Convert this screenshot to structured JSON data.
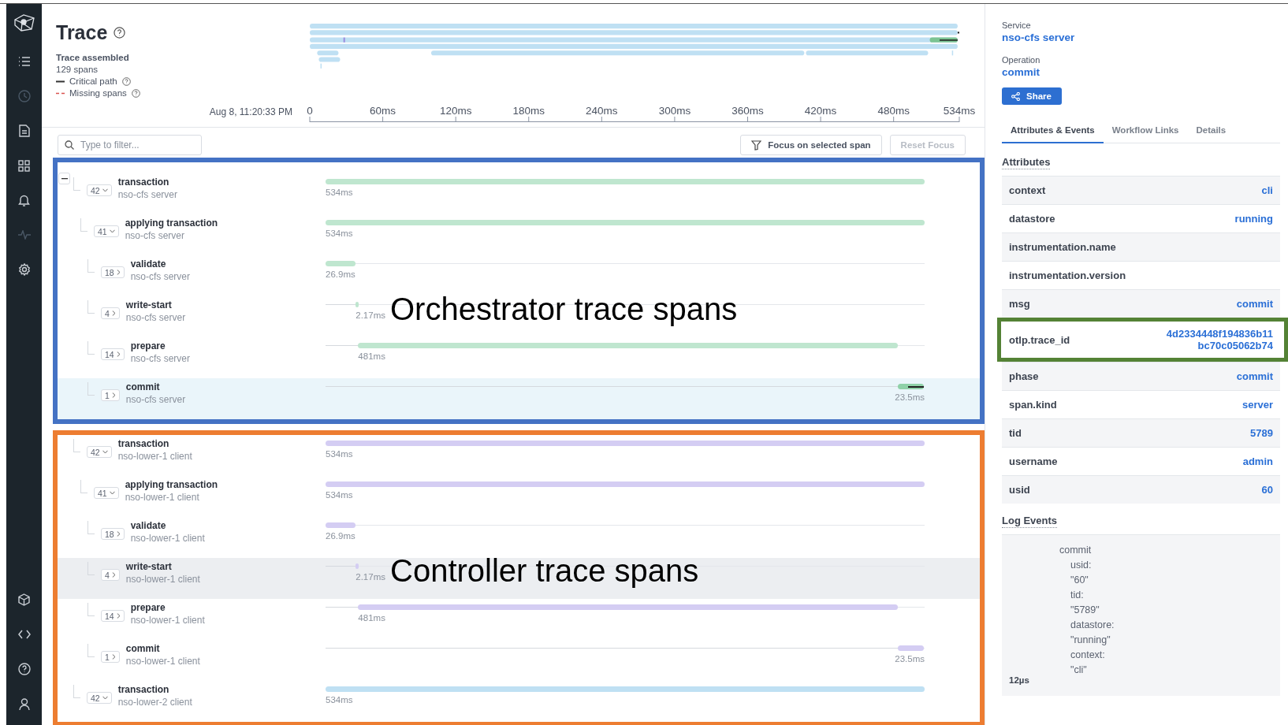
{
  "sidebar": {
    "items": [
      {
        "kind": "list",
        "disabled": false
      },
      {
        "kind": "clock",
        "disabled": true
      },
      {
        "kind": "document",
        "disabled": false
      },
      {
        "kind": "grid",
        "disabled": false
      },
      {
        "kind": "bell",
        "disabled": false
      },
      {
        "kind": "pulse",
        "disabled": true
      },
      {
        "kind": "gear",
        "disabled": false
      }
    ],
    "bottom_items": [
      {
        "kind": "cube",
        "disabled": false
      },
      {
        "kind": "code",
        "disabled": false
      },
      {
        "kind": "help",
        "disabled": false
      },
      {
        "kind": "user",
        "disabled": false
      }
    ]
  },
  "header": {
    "title": "Trace",
    "status": "Trace assembled",
    "span_count": "129 spans",
    "legend": [
      {
        "kind": "solid",
        "label": "Critical path"
      },
      {
        "kind": "dashed",
        "label": "Missing spans"
      }
    ],
    "timestamp": "Aug 8, 11:20:33 PM",
    "ticks": [
      "0",
      "60ms",
      "120ms",
      "180ms",
      "240ms",
      "300ms",
      "360ms",
      "420ms",
      "480ms",
      "534ms"
    ]
  },
  "filter": {
    "placeholder": "Type to filter..."
  },
  "focus_button": {
    "label": "Focus on selected span",
    "disabled": false
  },
  "reset_button": {
    "label": "Reset Focus",
    "disabled": true
  },
  "groups": [
    {
      "annotation": {
        "label": "Orchestrator trace spans",
        "color": "#4472c4"
      },
      "spans": [
        {
          "name": "transaction",
          "service": "nso-cfs server",
          "count": "42",
          "expanded": true,
          "duration": "534ms",
          "color": "#bfe6cf",
          "selected": false,
          "hovered": false,
          "children": [
            {
              "name": "applying transaction",
              "service": "nso-cfs server",
              "count": "41",
              "expanded": true,
              "duration": "534ms",
              "color": "#bfe6cf",
              "selected": false,
              "hovered": false,
              "children": [
                {
                  "name": "validate",
                  "service": "nso-cfs server",
                  "count": "18",
                  "expanded": false,
                  "duration": "26.9ms",
                  "color": "#bfe6cf",
                  "selected": false,
                  "hovered": false
                },
                {
                  "name": "write-start",
                  "service": "nso-cfs server",
                  "count": "4",
                  "expanded": false,
                  "duration": "2.17ms",
                  "color": "#bfe6cf",
                  "selected": false,
                  "hovered": false
                },
                {
                  "name": "prepare",
                  "service": "nso-cfs server",
                  "count": "14",
                  "expanded": false,
                  "duration": "481ms",
                  "color": "#bfe6cf",
                  "selected": false,
                  "hovered": false
                },
                {
                  "name": "commit",
                  "service": "nso-cfs server",
                  "count": "1",
                  "expanded": false,
                  "duration": "23.5ms",
                  "color": "#8fd1a8",
                  "selected": true,
                  "hovered": false
                }
              ]
            }
          ]
        }
      ]
    },
    {
      "annotation": {
        "label": "Controller trace spans",
        "color": "#ed7d31"
      },
      "spans": [
        {
          "name": "transaction",
          "service": "nso-lower-1 client",
          "count": "42",
          "expanded": true,
          "duration": "534ms",
          "color": "#d4cdf3",
          "selected": false,
          "hovered": false,
          "children": [
            {
              "name": "applying transaction",
              "service": "nso-lower-1 client",
              "count": "41",
              "expanded": true,
              "duration": "534ms",
              "color": "#d4cdf3",
              "selected": false,
              "hovered": false,
              "children": [
                {
                  "name": "validate",
                  "service": "nso-lower-1 client",
                  "count": "18",
                  "expanded": false,
                  "duration": "26.9ms",
                  "color": "#d4cdf3",
                  "selected": false,
                  "hovered": false
                },
                {
                  "name": "write-start",
                  "service": "nso-lower-1 client",
                  "count": "4",
                  "expanded": false,
                  "duration": "2.17ms",
                  "color": "#d4cdf3",
                  "selected": false,
                  "hovered": true
                },
                {
                  "name": "prepare",
                  "service": "nso-lower-1 client",
                  "count": "14",
                  "expanded": false,
                  "duration": "481ms",
                  "color": "#d4cdf3",
                  "selected": false,
                  "hovered": false
                },
                {
                  "name": "commit",
                  "service": "nso-lower-1 client",
                  "count": "1",
                  "expanded": false,
                  "duration": "23.5ms",
                  "color": "#d4cdf3",
                  "selected": false,
                  "hovered": false
                }
              ]
            }
          ]
        },
        {
          "name": "transaction",
          "service": "nso-lower-2 client",
          "count": "42",
          "expanded": true,
          "duration": "534ms",
          "color": "#bfe0f3",
          "selected": false,
          "hovered": false
        }
      ]
    }
  ],
  "details": {
    "service_label": "Service",
    "service": "nso-cfs server",
    "operation_label": "Operation",
    "operation": "commit",
    "share_button": "Share",
    "tabs": [
      {
        "label": "Attributes & Events",
        "selected": true
      },
      {
        "label": "Workflow Links",
        "selected": false
      },
      {
        "label": "Details",
        "selected": false
      }
    ],
    "attributes_heading": "Attributes",
    "attributes": [
      {
        "key": "context",
        "value": "cli",
        "highlighted": false
      },
      {
        "key": "datastore",
        "value": "running",
        "highlighted": false
      },
      {
        "key": "instrumentation.name",
        "highlighted": false
      },
      {
        "key": "instrumentation.version",
        "highlighted": false
      },
      {
        "key": "msg",
        "value": "commit",
        "highlighted": false
      },
      {
        "key": "otlp.trace_id",
        "value": "4d2334448f194836b11 bc70c05062b74",
        "highlighted": true
      },
      {
        "key": "phase",
        "value": "commit",
        "highlighted": false
      },
      {
        "key": "span.kind",
        "value": "server",
        "highlighted": false
      },
      {
        "key": "tid",
        "value": "5789",
        "highlighted": false
      },
      {
        "key": "username",
        "value": "admin",
        "highlighted": false
      },
      {
        "key": "usid",
        "value": "60",
        "highlighted": false
      }
    ],
    "log_heading": "Log Events",
    "log_event": {
      "time": "12µs",
      "message": "commit",
      "fields": [
        {
          "key": "usid:",
          "value": "\"60\""
        },
        {
          "key": "tid:",
          "value": "\"5789\""
        },
        {
          "key": "datastore:",
          "value": "\"running\""
        },
        {
          "key": "context:",
          "value": "\"cli\""
        }
      ]
    }
  }
}
